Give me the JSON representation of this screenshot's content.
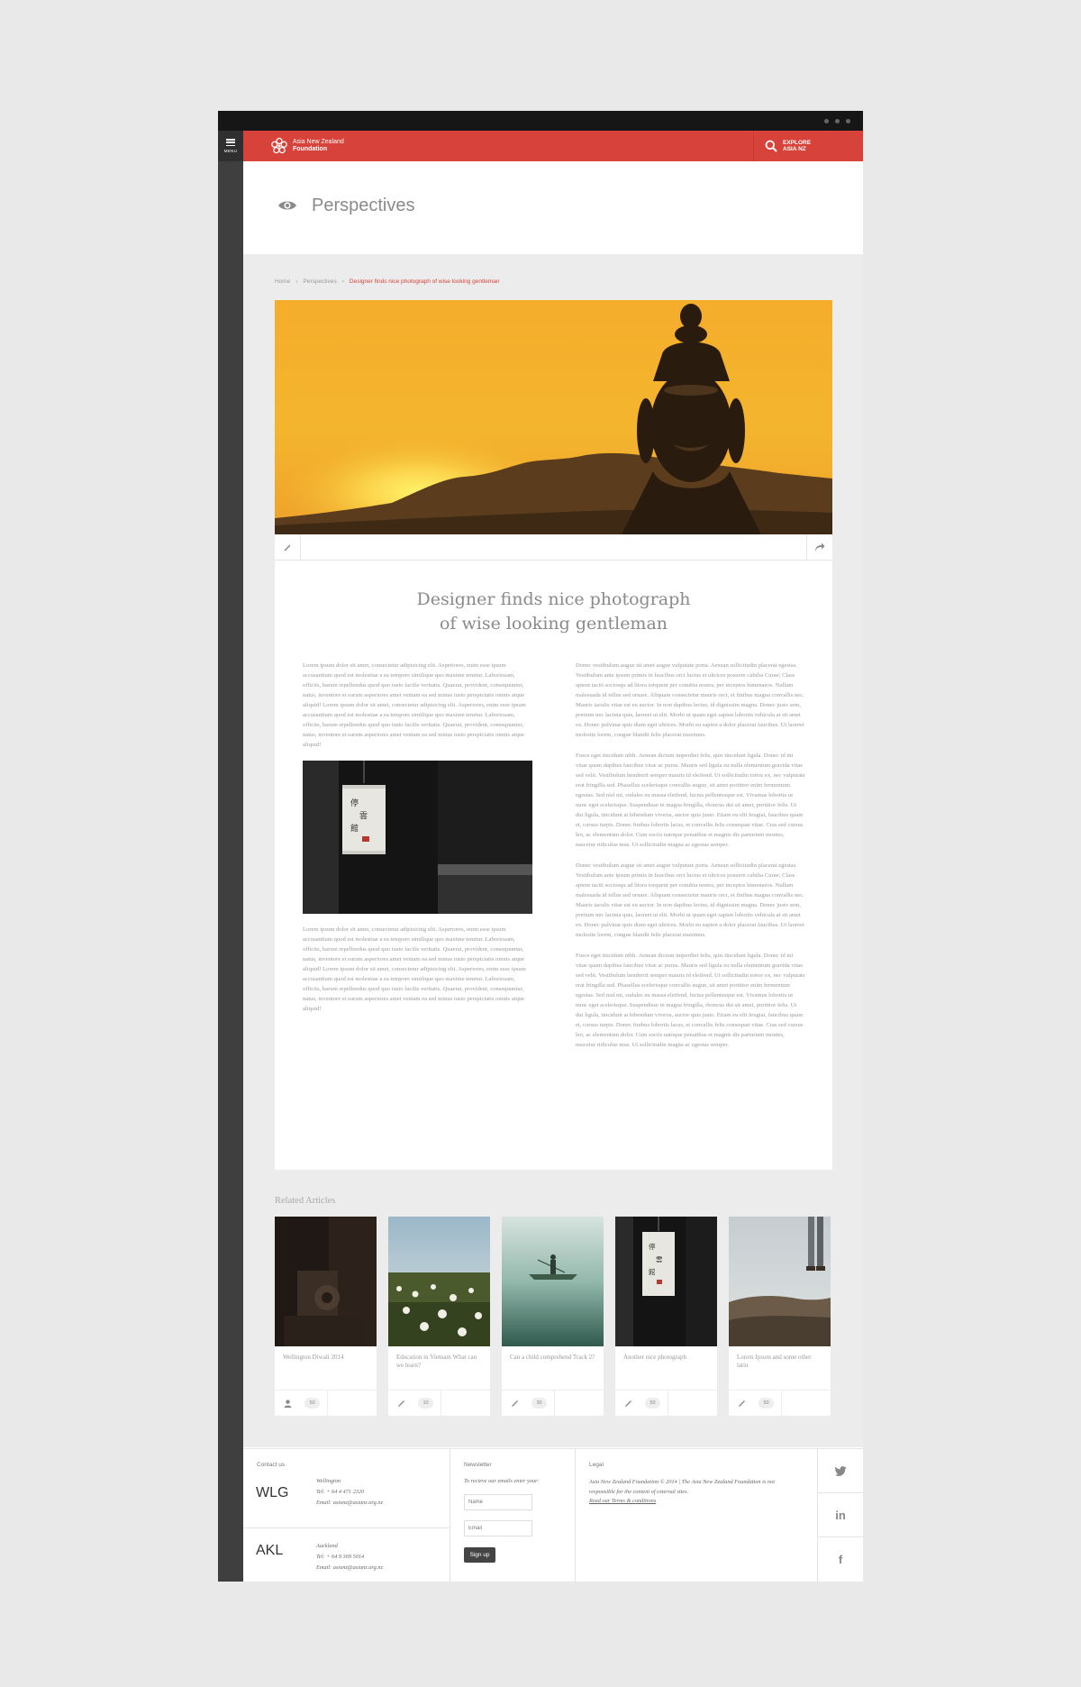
{
  "menu_label": "MENU",
  "brand": {
    "line1": "Asia New Zealand",
    "line2": "Foundation"
  },
  "explore": {
    "line1": "EXPLORE",
    "line2": "ASIA NZ"
  },
  "page_title": "Perspectives",
  "breadcrumb": {
    "home": "Home",
    "section": "Perspectives",
    "current": "Designer finds nice photograph of wise looking gentleman"
  },
  "article": {
    "title_line1": "Designer finds nice photograph",
    "title_line2": "of wise looking gentleman",
    "left_p1": "Lorem ipsum dolor sit amet, consectetur adipisicing elit. Asperiores, enim esse ipsum accusantium quod est molestiae a ea tempore similique quo maxime tenetur. Laboriosam, officiis, harum repellendus quod quo iusto facilis veritatis. Quaerat, provident, consequuntur, natus, inventore et earum asperiores amet veniam ea sed minus iusto perspiciatis omnis atque aliquid! Lorem ipsum dolor sit amet, consectetur adipisicing elit. Asperiores, enim esse ipsum accusantium quod est molestiae a ea tempore similique quo maxime tenetur. Laboriosam, officiis, harum repellendus quod quo iusto facilis veritatis. Quaerat, provident, consequuntur, natus, inventore et earum asperiores amet veniam ea sed minus iusto perspiciatis omnis atque aliquid!",
    "left_p2": "Lorem ipsum dolor sit amet, consectetur adipisicing elit. Asperiores, enim esse ipsum accusantium quod est molestiae a ea tempore similique quo maxime tenetur. Laboriosam, officiis, harum repellendus quod quo iusto facilis veritatis. Quaerat, provident, consequuntur, natus, inventore et earum asperiores amet veniam ea sed minus iusto perspiciatis omnis atque aliquid! Lorem ipsum dolor sit amet, consectetur adipisicing elit. Asperiores, enim esse ipsum accusantium quod est molestiae a ea tempore similique quo maxime tenetur. Laboriosam, officiis, harum repellendus quod quo iusto facilis veritatis. Quaerat, provident, consequuntur, natus, inventore et earum asperiores amet veniam ea sed minus iusto perspiciatis omnis atque aliquid!",
    "right_p1": "Donec vestibulum augue sit amet augue vulputate porta. Aenean sollicitudin placerat egestas. Vestibulum ante ipsum primis in faucibus orci luctus et ultrices posuere cubilia Curae; Class aptent taciti sociosqu ad litora torquent per conubia nostra, per inceptos himenaeos. Nullam malesuada id tellus sed ornare. Aliquam consectetur mauris orci, et finibus magna convallis nec. Mauris iaculis vitae est eu auctor. In non dapibus lectus, id dignissim magna. Donec justo sem, pretium nec lacinia quis, laoreet ut elit. Morbi ut quam eget sapien lobortis vehicula at sit amet ex. Donec pulvinar quis diam eget ultrices. Morbi eu sapien a dolor placerat faucibus. Ut laoreet molestie lorem, congue blandit felis placerat maximus.",
    "right_p2": "Fusce eget tincidunt nibh. Aenean dictum imperdiet felis, quis tincidunt ligula. Donec id mi vitae quam dapibus faucibus vitae ac purus. Mauris sed ligula eu nulla elementum gravida vitae sed velit. Vestibulum hendrerit semper mauris id eleifend. Ut sollicitudin tortor ex, nec vulputate erat fringilla sed. Phasellus scelerisque convallis augue, sit amet porttitor enim fermentum egestas. Sed nisl mi, sodales eu massa eleifend, luctus pellentesque est. Vivamus lobortis ut nunc eget scelerisque. Suspendisse in magna fringilla, rhoncus dui sit amet, porttitor felis. Ut dui ligula, tincidunt at bibendum viverra, auctor quis justo. Etiam eu elit feugiat, faucibus quam et, cursus turpis. Donec finibus lobortis lacus, et convallis felis consequat vitae. Cras sed cursus leo, ac elementum dolor. Cum sociis natoque penatibus et magnis dis parturient montes, nascetur ridiculus mus. Ut sollicitudin magna ac egestas semper.",
    "right_p3": "Donec vestibulum augue sit amet augue vulputate porta. Aenean sollicitudin placerat egestas. Vestibulum ante ipsum primis in faucibus orci luctus et ultrices posuere cubilia Curae; Class aptent taciti sociosqu ad litora torquent per conubia nostra, per inceptos himenaeos. Nullam malesuada id tellus sed ornare. Aliquam consectetur mauris orci, et finibus magna convallis nec. Mauris iaculis vitae est eu auctor. In non dapibus lectus, id dignissim magna. Donec justo sem, pretium nec lacinia quis, laoreet ut elit. Morbi ut quam eget sapien lobortis vehicula at sit amet ex. Donec pulvinar quis diam eget ultrices. Morbi eu sapien a dolor placerat faucibus. Ut laoreet molestie lorem, congue blandit felis placerat maximus.",
    "right_p4": "Fusce eget tincidunt nibh. Aenean dictum imperdiet felis, quis tincidunt ligula. Donec id mi vitae quam dapibus faucibus vitae ac purus. Mauris sed ligula eu nulla elementum gravida vitae sed velit. Vestibulum hendrerit semper mauris id eleifend. Ut sollicitudin tortor ex, nec vulputate erat fringilla sed. Phasellus scelerisque convallis augue, sit amet porttitor enim fermentum egestas. Sed nisl mi, sodales eu massa eleifend, luctus pellentesque est. Vivamus lobortis ut nunc eget scelerisque. Suspendisse in magna fringilla, rhoncus dui sit amet, porttitor felis. Ut dui ligula, tincidunt at bibendum viverra, auctor quis justo. Etiam eu elit feugiat, faucibus quam et, cursus turpis. Donec finibus lobortis lacus, et convallis felis consequat vitae. Cras sed cursus leo, ac elementum dolor. Cum sociis natoque penatibus et magnis dis parturient montes, nascetur ridiculus mus. Ut sollicitudin magna ac egestas semper."
  },
  "related": {
    "heading": "Related Articles",
    "cards": [
      {
        "title": "Wellington Diwali 2014",
        "count": "50",
        "icon": "user-icon"
      },
      {
        "title": "Education in Vietnam What can we learn?",
        "count": "10",
        "icon": "pencil-icon"
      },
      {
        "title": "Can a child comprehend Track 2?",
        "count": "30",
        "icon": "pencil-icon"
      },
      {
        "title": "Another nice photograph",
        "count": "50",
        "icon": "pencil-icon"
      },
      {
        "title": "Lorem Ipsum and some other latin",
        "count": "50",
        "icon": "pencil-icon"
      }
    ]
  },
  "footer": {
    "contact_heading": "Contact us",
    "wellington": {
      "code": "WLG",
      "city": "Wellington",
      "tel": "Tel: + 64 4 471 2320",
      "email": "Email: asianz@asianz.org.nz"
    },
    "auckland": {
      "code": "AKL",
      "city": "Auckland",
      "tel": "Tel: + 64 9 369 5014",
      "email": "Email: asianz@asianz.org.nz"
    },
    "newsletter_heading": "Newsletter",
    "newsletter_sub": "To recieve our emails enter your:",
    "name_placeholder": "Name",
    "email_placeholder": "Email",
    "signup_label": "Sign up",
    "legal_heading": "Legal",
    "legal_text": "Asia New Zealand Foundation © 2014 | The Asia New Zealand Foundation is not responsible for the content of external sites.",
    "legal_link": "Read our Terms & conditions",
    "social": {
      "twitter": "twitter-icon",
      "linkedin": "in",
      "facebook": "f"
    }
  },
  "colors": {
    "brand_red": "#d7433a",
    "sidebar": "#3f3f3f",
    "background": "#e9e9e9"
  }
}
